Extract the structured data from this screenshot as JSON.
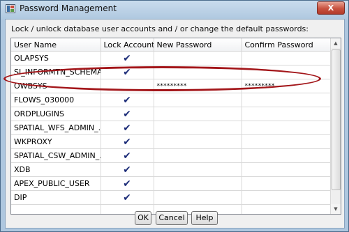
{
  "window": {
    "title": "Password Management",
    "close_glyph": "X"
  },
  "instructions": "Lock / unlock database user accounts and / or change the default passwords:",
  "table": {
    "columns": [
      "User Name",
      "Lock Account?",
      "New Password",
      "Confirm Password"
    ],
    "rows": [
      {
        "user": "OLAPSYS",
        "locked": true,
        "new_password": "",
        "confirm_password": ""
      },
      {
        "user": "SI_INFORMTN_SCHEMA",
        "locked": true,
        "new_password": "",
        "confirm_password": ""
      },
      {
        "user": "OWBSYS",
        "locked": false,
        "new_password": "*********",
        "confirm_password": "*********"
      },
      {
        "user": "FLOWS_030000",
        "locked": true,
        "new_password": "",
        "confirm_password": ""
      },
      {
        "user": "ORDPLUGINS",
        "locked": true,
        "new_password": "",
        "confirm_password": ""
      },
      {
        "user": "SPATIAL_WFS_ADMIN_...",
        "locked": true,
        "new_password": "",
        "confirm_password": ""
      },
      {
        "user": "WKPROXY",
        "locked": true,
        "new_password": "",
        "confirm_password": ""
      },
      {
        "user": "SPATIAL_CSW_ADMIN_...",
        "locked": true,
        "new_password": "",
        "confirm_password": ""
      },
      {
        "user": "XDB",
        "locked": true,
        "new_password": "",
        "confirm_password": ""
      },
      {
        "user": "APEX_PUBLIC_USER",
        "locked": true,
        "new_password": "",
        "confirm_password": ""
      },
      {
        "user": "DIP",
        "locked": true,
        "new_password": "",
        "confirm_password": ""
      },
      {
        "user": "",
        "locked": false,
        "new_password": "",
        "confirm_password": ""
      }
    ]
  },
  "buttons": {
    "ok": "OK",
    "cancel": "Cancel",
    "help": "Help"
  },
  "checkmark_glyph": "✔",
  "colors": {
    "annotation": "#a3161a",
    "checkmark": "#1f2f7a"
  }
}
